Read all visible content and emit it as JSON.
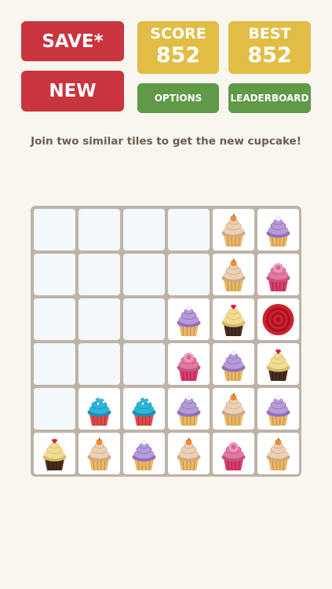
{
  "header": {
    "save_label": "SAVE*",
    "new_label": "NEW",
    "options_label": "OPTIONS",
    "leaderboard_label": "LEADERBOARD",
    "score": {
      "label": "SCORE",
      "value": "852"
    },
    "best": {
      "label": "BEST",
      "value": "852"
    }
  },
  "instruction": "Join two similar tiles to get the new cupcake!",
  "board": {
    "rows": 6,
    "cols": 6,
    "tiles": [
      [
        "empty",
        "empty",
        "empty",
        "empty",
        "vanilla-orange",
        "purple"
      ],
      [
        "empty",
        "empty",
        "empty",
        "empty",
        "vanilla-orange",
        "pink-rose"
      ],
      [
        "empty",
        "empty",
        "empty",
        "purple",
        "chocolate-cherry",
        "red-rose"
      ],
      [
        "empty",
        "empty",
        "empty",
        "pink-rose",
        "purple",
        "chocolate-cherry"
      ],
      [
        "empty",
        "blue",
        "blue",
        "purple",
        "vanilla-orange",
        "purple"
      ],
      [
        "chocolate-cherry",
        "vanilla-orange",
        "purple",
        "vanilla-orange",
        "pink-rose",
        "vanilla-orange"
      ]
    ]
  },
  "colors": {
    "red_button": "#c9343f",
    "yellow_box": "#e2bd45",
    "green_button": "#5f9a46",
    "board_frame": "#bfb3a7",
    "empty_cell": "#f3f9fc"
  }
}
